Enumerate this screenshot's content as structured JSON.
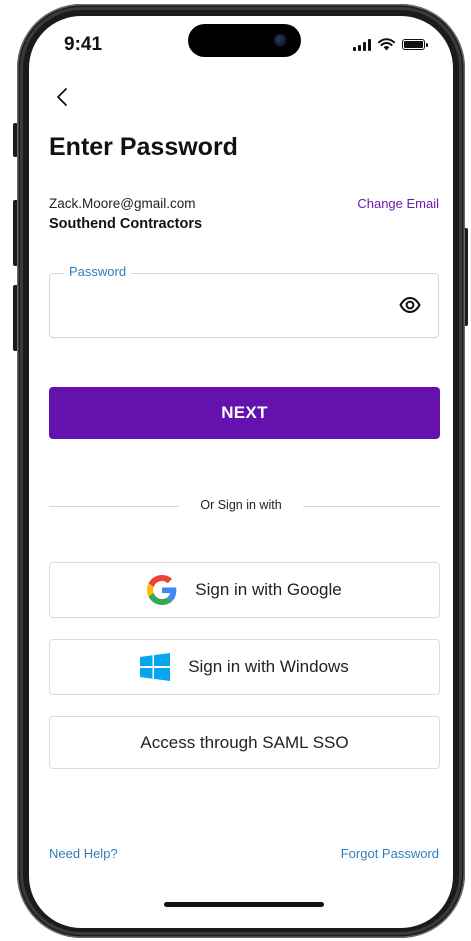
{
  "status_bar": {
    "time": "9:41"
  },
  "header": {
    "title": "Enter Password"
  },
  "account": {
    "email": "Zack.Moore@gmail.com",
    "company": "Southend Contractors",
    "change_email_label": "Change Email"
  },
  "password_field": {
    "label": "Password",
    "value": "",
    "icon": "eye-icon"
  },
  "next_button": {
    "label": "NEXT",
    "color": "#6411ad"
  },
  "divider": {
    "label": "Or Sign in with"
  },
  "alt_signin": {
    "google_label": "Sign in with Google",
    "windows_label": "Sign in with Windows",
    "saml_label": "Access through SAML SSO"
  },
  "footer": {
    "help_label": "Need Help?",
    "forgot_label": "Forgot Password"
  },
  "colors": {
    "accent": "#6411ad",
    "link": "#2f7fb8",
    "change_email": "#6a1bb0"
  }
}
